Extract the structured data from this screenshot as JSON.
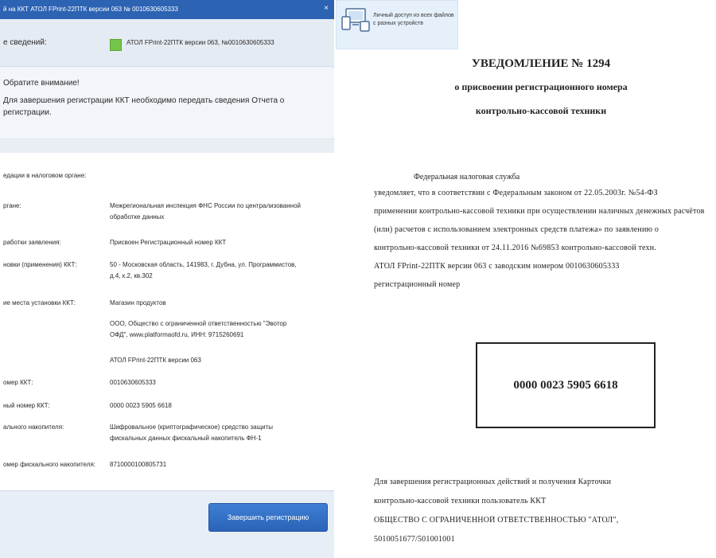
{
  "dialog": {
    "title": "й на ККТ АТОЛ FPrint-22ПТК версии 063 № 0010630605333",
    "close_glyph": "×",
    "status_label": "е сведений:",
    "status_text": "АТОЛ FPrint-22ПТК версии 063, №0010630605333",
    "notice_title": "Обратите внимание!",
    "notice_body": "Для завершения регистрации ККТ необходимо передать сведения Отчета о регистрации.",
    "details_heading": "едации в налоговом органе:",
    "rows": [
      {
        "label": "ргане:",
        "value": "Межрегиональная инспекция ФНС России по централизованной обработке данных"
      },
      {
        "label": "работки заявления:",
        "value": "Присвоен Регистрационный номер ККТ"
      },
      {
        "label": "новки (применения) ККТ:",
        "value": "50 - Московская область, 141983, г. Дубна, ул. Программистов, д.4, к.2, кв.302"
      },
      {
        "label": "ие места установки ККТ:",
        "value": "Магазин продуктов"
      },
      {
        "label": "",
        "value": "ООО, Общество с ограниченной ответственностью \"Эвотор ОФД\", www.platformaofd.ru, ИНН: 9715260691"
      },
      {
        "label": "",
        "value": "АТОЛ FPrint-22ПТК версии 063"
      },
      {
        "label": "омер ККТ:",
        "value": "0010630605333"
      },
      {
        "label": "ный номер ККТ:",
        "value": "0000 0023 5905 6618"
      },
      {
        "label": "ального накопителя:",
        "value": "Шифровальное (криптографическое) средство защиты фискальных данных фискальный накопитель ФН-1"
      },
      {
        "label": "омер фискального накопителя:",
        "value": "8710000100805731"
      }
    ],
    "finish_button": "Завершить регистрацию"
  },
  "quick_access": {
    "text": "Личный доступ из всех файлов с разных устройств"
  },
  "document": {
    "title_line1": "УВЕДОМЛЕНИЕ № 1294",
    "title_line2": "о присвоении регистрационного номера",
    "title_line3": "контрольно-кассовой техники",
    "org": "Федеральная налоговая служба",
    "body_lines": [
      "уведомляет, что в соответствии с Федеральным законом от 22.05.2003г. №54-ФЗ",
      "применении контрольно-кассовой техники при осуществлении наличных денежных расчётов",
      "(или) расчетов с использованием электронных средств платежа» по заявлению о",
      "контрольно-кассовой техники от 24.11.2016 №69853 контрольно-кассовой техн.",
      "АТОЛ FPrint-22ПТК версии 063 с заводским номером 0010630605333",
      "регистрационный номер"
    ],
    "reg_number": "0000 0023 5905 6618",
    "footer_lines": [
      "Для завершения регистрационных действий и получения Карточки",
      "контрольно-кассовой техники пользователь ККТ",
      "ОБЩЕСТВО С ОГРАНИЧЕННОЙ ОТВЕТСТВЕННОСТЬЮ \"АТОЛ\",",
      "5010051677/501001001"
    ]
  }
}
